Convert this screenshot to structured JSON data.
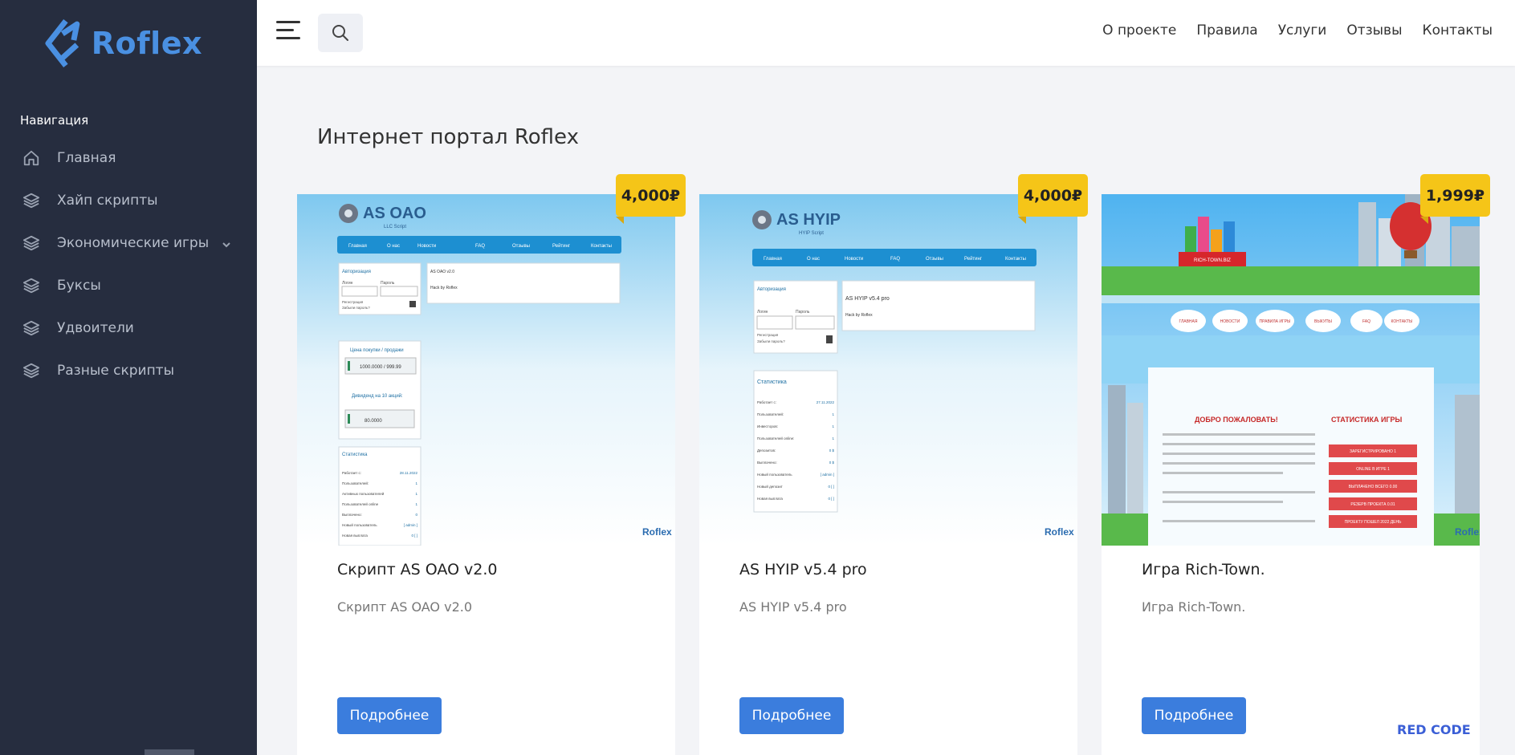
{
  "brand": {
    "name": "Roflex",
    "color": "#4a90e2"
  },
  "sidebar": {
    "title": "Навигация",
    "items": [
      {
        "label": "Главная",
        "icon": "home-icon"
      },
      {
        "label": "Хайп скрипты",
        "icon": "layers-icon"
      },
      {
        "label": "Экономические игры",
        "icon": "layers-icon",
        "has_submenu": true
      },
      {
        "label": "Буксы",
        "icon": "layers-icon"
      },
      {
        "label": "Удвоители",
        "icon": "layers-icon"
      },
      {
        "label": "Разные скрипты",
        "icon": "layers-icon"
      }
    ]
  },
  "header": {
    "nav": [
      "О проекте",
      "Правила",
      "Услуги",
      "Отзывы",
      "Контакты"
    ]
  },
  "main": {
    "title": "Интернет портал Roflex",
    "cards": [
      {
        "title": "Скрипт AS OAO v2.0",
        "description": "Скрипт AS OAO v2.0",
        "price": "4,000₽",
        "button": "Подробнее"
      },
      {
        "title": "AS HYIP v5.4 pro",
        "description": "AS HYIP v5.4 pro",
        "price": "4,000₽",
        "button": "Подробнее"
      },
      {
        "title": "Игра Rich-Town.",
        "description": "Игра Rich-Town.",
        "price": "1,999₽",
        "button": "Подробнее"
      }
    ]
  },
  "thumbs": {
    "oao": {
      "logo": "AS OAO",
      "sub": "LLC Script",
      "menu": [
        "Главная",
        "О нас",
        "Новости",
        "FAQ",
        "Отзывы",
        "Рейтинг",
        "Контакты"
      ],
      "auth": "Авторизация",
      "login": "Логин",
      "pass": "Пароль",
      "reg": "Регистрация",
      "forgot": "Забыли пароль?",
      "panel_title": "AS OAO v2.0",
      "panel_text": "Hack by Roflex",
      "price_title": "Цена покупки / продажи",
      "price_value": "1000.0000 / 999.99",
      "dividend_title": "Дивиденд на 10 акций:",
      "dividend_value": "80.0000",
      "stats_title": "Статистика",
      "stats": [
        "Работает с:",
        "Пользователей:",
        "Активных пользователей",
        "Пользователей online",
        "Выплачено:",
        "Новый пользователь",
        "Новая выплата"
      ],
      "stats_values": [
        "28.11.2022",
        "1",
        "1",
        "1",
        "0",
        "[ admin ]",
        "0 [ ]"
      ],
      "watermark": "Roflex"
    },
    "hyip": {
      "logo": "AS HYIP",
      "sub": "HYIP Script",
      "menu": [
        "Главная",
        "О нас",
        "Новости",
        "FAQ",
        "Отзывы",
        "Рейтинг",
        "Контакты"
      ],
      "auth": "Авторизация",
      "login": "Логин",
      "pass": "Пароль",
      "reg": "Регистрация",
      "forgot": "Забыли пароль?",
      "panel_title": "AS HYIP v5.4 pro",
      "panel_text": "Hack by Roflex",
      "stats_title": "Статистика",
      "stats": [
        "Работает с:",
        "Пользователей:",
        "Инвесторов:",
        "Пользователей online:",
        "Депозитов:",
        "Выплачено:",
        "Новый пользователь",
        "Новый депозит",
        "Новая выплата"
      ],
      "stats_values": [
        "27.11.2022",
        "1",
        "1",
        "1",
        "0 $",
        "0 $",
        "[ admin ]",
        "0 [ ]",
        "0 [ ]"
      ],
      "watermark": "Roflex"
    },
    "rich": {
      "sign": "RICH-TOWN.BIZ",
      "menu": [
        "ГЛАВНАЯ",
        "НОВОСТИ",
        "ПРАВИЛА ИГРЫ",
        "ВЫКУПЫ",
        "FAQ",
        "КОНТАКТЫ"
      ],
      "welcome": "ДОБРО ПОЖАЛОВАТЬ!",
      "stats_title": "СТАТИСТИКА ИГРЫ",
      "stats": [
        "ЗАРЕГИСТРИРОВАНО 1",
        "ONLINE В ИГРЕ 1",
        "ВЫПЛАЧЕНО ВСЕГО 0.00",
        "РЕЗЕРВ ПРОЕКТА 0.01",
        "ПРОЕКТУ ПОШЕЛ 2022 ДЕНЬ"
      ],
      "watermark": "Roflex"
    }
  },
  "corner_logo": "RED CODE"
}
